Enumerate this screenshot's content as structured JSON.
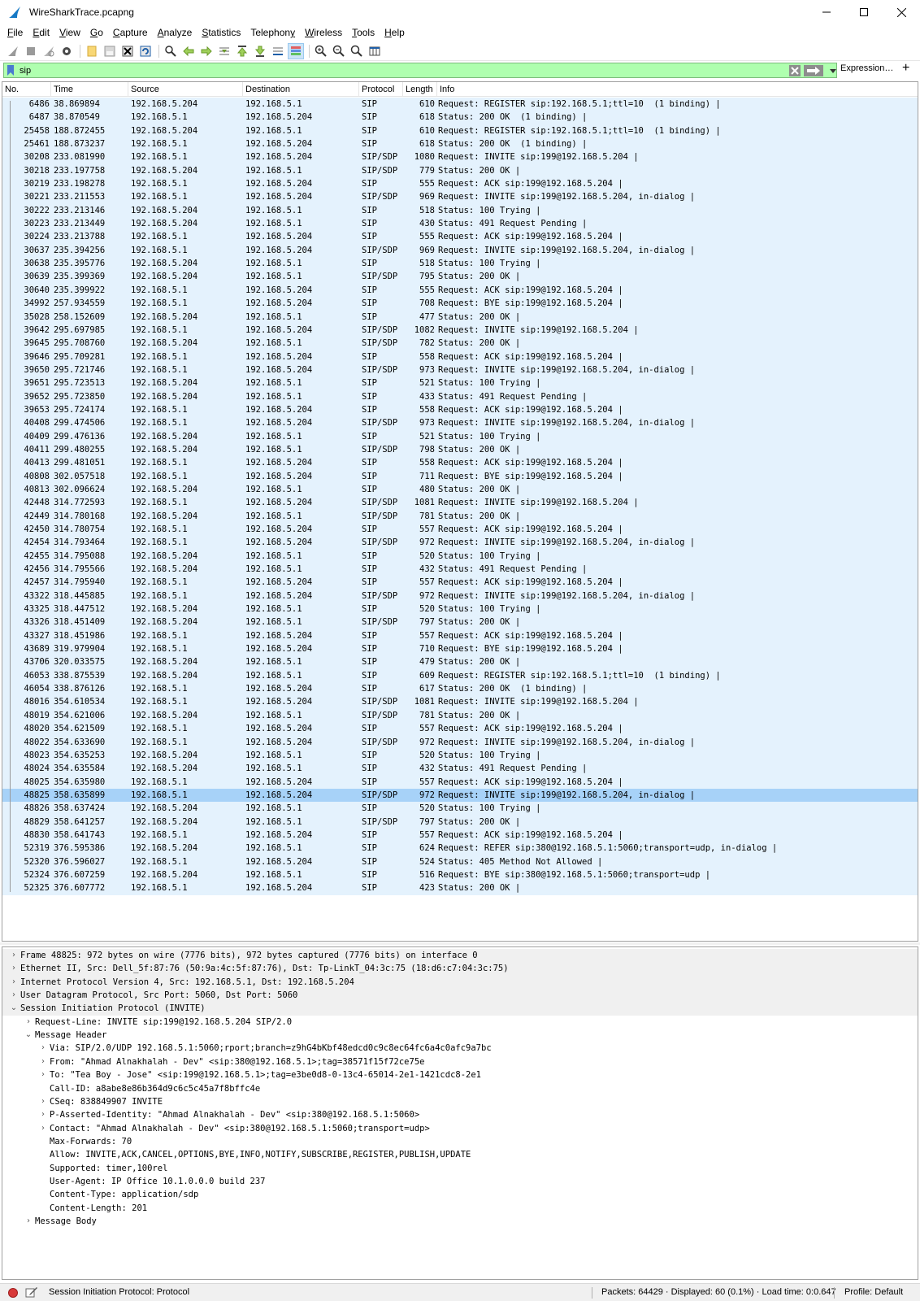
{
  "window": {
    "title": "WireSharkTrace.pcapng",
    "minimize_icon": "minimize-icon",
    "maximize_icon": "maximize-icon",
    "close_icon": "close-icon"
  },
  "menu": [
    {
      "label": "File",
      "key": "F",
      "rest": "ile"
    },
    {
      "label": "Edit",
      "key": "E",
      "rest": "dit"
    },
    {
      "label": "View",
      "key": "V",
      "rest": "iew"
    },
    {
      "label": "Go",
      "key": "G",
      "rest": "o"
    },
    {
      "label": "Capture",
      "key": "C",
      "rest": "apture"
    },
    {
      "label": "Analyze",
      "key": "A",
      "rest": "nalyze"
    },
    {
      "label": "Statistics",
      "key": "S",
      "rest": "tatistics"
    },
    {
      "label": "Telephony",
      "pre": "Telephon",
      "key": "y",
      "rest": ""
    },
    {
      "label": "Wireless",
      "key": "W",
      "rest": "ireless"
    },
    {
      "label": "Tools",
      "key": "T",
      "rest": "ools"
    },
    {
      "label": "Help",
      "key": "H",
      "rest": "elp"
    }
  ],
  "filter": {
    "value": "sip",
    "expression_label": "Expression…",
    "add_label": "+",
    "background": "#afffaf"
  },
  "columns": [
    "No.",
    "Time",
    "Source",
    "Destination",
    "Protocol",
    "Length",
    "Info"
  ],
  "packets": [
    [
      "6486",
      "38.869894",
      "192.168.5.204",
      "192.168.5.1",
      "SIP",
      "610",
      "Request: REGISTER sip:192.168.5.1;ttl=10  (1 binding) |"
    ],
    [
      "6487",
      "38.870549",
      "192.168.5.1",
      "192.168.5.204",
      "SIP",
      "618",
      "Status: 200 OK  (1 binding) |"
    ],
    [
      "25458",
      "188.872455",
      "192.168.5.204",
      "192.168.5.1",
      "SIP",
      "610",
      "Request: REGISTER sip:192.168.5.1;ttl=10  (1 binding) |"
    ],
    [
      "25461",
      "188.873237",
      "192.168.5.1",
      "192.168.5.204",
      "SIP",
      "618",
      "Status: 200 OK  (1 binding) |"
    ],
    [
      "30208",
      "233.081990",
      "192.168.5.1",
      "192.168.5.204",
      "SIP/SDP",
      "1080",
      "Request: INVITE sip:199@192.168.5.204 |"
    ],
    [
      "30218",
      "233.197758",
      "192.168.5.204",
      "192.168.5.1",
      "SIP/SDP",
      "779",
      "Status: 200 OK |"
    ],
    [
      "30219",
      "233.198278",
      "192.168.5.1",
      "192.168.5.204",
      "SIP",
      "555",
      "Request: ACK sip:199@192.168.5.204 |"
    ],
    [
      "30221",
      "233.211553",
      "192.168.5.1",
      "192.168.5.204",
      "SIP/SDP",
      "969",
      "Request: INVITE sip:199@192.168.5.204, in-dialog |"
    ],
    [
      "30222",
      "233.213146",
      "192.168.5.204",
      "192.168.5.1",
      "SIP",
      "518",
      "Status: 100 Trying |"
    ],
    [
      "30223",
      "233.213449",
      "192.168.5.204",
      "192.168.5.1",
      "SIP",
      "430",
      "Status: 491 Request Pending |"
    ],
    [
      "30224",
      "233.213788",
      "192.168.5.1",
      "192.168.5.204",
      "SIP",
      "555",
      "Request: ACK sip:199@192.168.5.204 |"
    ],
    [
      "30637",
      "235.394256",
      "192.168.5.1",
      "192.168.5.204",
      "SIP/SDP",
      "969",
      "Request: INVITE sip:199@192.168.5.204, in-dialog |"
    ],
    [
      "30638",
      "235.395776",
      "192.168.5.204",
      "192.168.5.1",
      "SIP",
      "518",
      "Status: 100 Trying |"
    ],
    [
      "30639",
      "235.399369",
      "192.168.5.204",
      "192.168.5.1",
      "SIP/SDP",
      "795",
      "Status: 200 OK |"
    ],
    [
      "30640",
      "235.399922",
      "192.168.5.1",
      "192.168.5.204",
      "SIP",
      "555",
      "Request: ACK sip:199@192.168.5.204 |"
    ],
    [
      "34992",
      "257.934559",
      "192.168.5.1",
      "192.168.5.204",
      "SIP",
      "708",
      "Request: BYE sip:199@192.168.5.204 |"
    ],
    [
      "35028",
      "258.152609",
      "192.168.5.204",
      "192.168.5.1",
      "SIP",
      "477",
      "Status: 200 OK |"
    ],
    [
      "39642",
      "295.697985",
      "192.168.5.1",
      "192.168.5.204",
      "SIP/SDP",
      "1082",
      "Request: INVITE sip:199@192.168.5.204 |"
    ],
    [
      "39645",
      "295.708760",
      "192.168.5.204",
      "192.168.5.1",
      "SIP/SDP",
      "782",
      "Status: 200 OK |"
    ],
    [
      "39646",
      "295.709281",
      "192.168.5.1",
      "192.168.5.204",
      "SIP",
      "558",
      "Request: ACK sip:199@192.168.5.204 |"
    ],
    [
      "39650",
      "295.721746",
      "192.168.5.1",
      "192.168.5.204",
      "SIP/SDP",
      "973",
      "Request: INVITE sip:199@192.168.5.204, in-dialog |"
    ],
    [
      "39651",
      "295.723513",
      "192.168.5.204",
      "192.168.5.1",
      "SIP",
      "521",
      "Status: 100 Trying |"
    ],
    [
      "39652",
      "295.723850",
      "192.168.5.204",
      "192.168.5.1",
      "SIP",
      "433",
      "Status: 491 Request Pending |"
    ],
    [
      "39653",
      "295.724174",
      "192.168.5.1",
      "192.168.5.204",
      "SIP",
      "558",
      "Request: ACK sip:199@192.168.5.204 |"
    ],
    [
      "40408",
      "299.474506",
      "192.168.5.1",
      "192.168.5.204",
      "SIP/SDP",
      "973",
      "Request: INVITE sip:199@192.168.5.204, in-dialog |"
    ],
    [
      "40409",
      "299.476136",
      "192.168.5.204",
      "192.168.5.1",
      "SIP",
      "521",
      "Status: 100 Trying |"
    ],
    [
      "40411",
      "299.480255",
      "192.168.5.204",
      "192.168.5.1",
      "SIP/SDP",
      "798",
      "Status: 200 OK |"
    ],
    [
      "40413",
      "299.481051",
      "192.168.5.1",
      "192.168.5.204",
      "SIP",
      "558",
      "Request: ACK sip:199@192.168.5.204 |"
    ],
    [
      "40808",
      "302.057518",
      "192.168.5.1",
      "192.168.5.204",
      "SIP",
      "711",
      "Request: BYE sip:199@192.168.5.204 |"
    ],
    [
      "40813",
      "302.096624",
      "192.168.5.204",
      "192.168.5.1",
      "SIP",
      "480",
      "Status: 200 OK |"
    ],
    [
      "42448",
      "314.772593",
      "192.168.5.1",
      "192.168.5.204",
      "SIP/SDP",
      "1081",
      "Request: INVITE sip:199@192.168.5.204 |"
    ],
    [
      "42449",
      "314.780168",
      "192.168.5.204",
      "192.168.5.1",
      "SIP/SDP",
      "781",
      "Status: 200 OK |"
    ],
    [
      "42450",
      "314.780754",
      "192.168.5.1",
      "192.168.5.204",
      "SIP",
      "557",
      "Request: ACK sip:199@192.168.5.204 |"
    ],
    [
      "42454",
      "314.793464",
      "192.168.5.1",
      "192.168.5.204",
      "SIP/SDP",
      "972",
      "Request: INVITE sip:199@192.168.5.204, in-dialog |"
    ],
    [
      "42455",
      "314.795088",
      "192.168.5.204",
      "192.168.5.1",
      "SIP",
      "520",
      "Status: 100 Trying |"
    ],
    [
      "42456",
      "314.795566",
      "192.168.5.204",
      "192.168.5.1",
      "SIP",
      "432",
      "Status: 491 Request Pending |"
    ],
    [
      "42457",
      "314.795940",
      "192.168.5.1",
      "192.168.5.204",
      "SIP",
      "557",
      "Request: ACK sip:199@192.168.5.204 |"
    ],
    [
      "43322",
      "318.445885",
      "192.168.5.1",
      "192.168.5.204",
      "SIP/SDP",
      "972",
      "Request: INVITE sip:199@192.168.5.204, in-dialog |"
    ],
    [
      "43325",
      "318.447512",
      "192.168.5.204",
      "192.168.5.1",
      "SIP",
      "520",
      "Status: 100 Trying |"
    ],
    [
      "43326",
      "318.451409",
      "192.168.5.204",
      "192.168.5.1",
      "SIP/SDP",
      "797",
      "Status: 200 OK |"
    ],
    [
      "43327",
      "318.451986",
      "192.168.5.1",
      "192.168.5.204",
      "SIP",
      "557",
      "Request: ACK sip:199@192.168.5.204 |"
    ],
    [
      "43689",
      "319.979904",
      "192.168.5.1",
      "192.168.5.204",
      "SIP",
      "710",
      "Request: BYE sip:199@192.168.5.204 |"
    ],
    [
      "43706",
      "320.033575",
      "192.168.5.204",
      "192.168.5.1",
      "SIP",
      "479",
      "Status: 200 OK |"
    ],
    [
      "46053",
      "338.875539",
      "192.168.5.204",
      "192.168.5.1",
      "SIP",
      "609",
      "Request: REGISTER sip:192.168.5.1;ttl=10  (1 binding) |"
    ],
    [
      "46054",
      "338.876126",
      "192.168.5.1",
      "192.168.5.204",
      "SIP",
      "617",
      "Status: 200 OK  (1 binding) |"
    ],
    [
      "48016",
      "354.610534",
      "192.168.5.1",
      "192.168.5.204",
      "SIP/SDP",
      "1081",
      "Request: INVITE sip:199@192.168.5.204 |"
    ],
    [
      "48019",
      "354.621006",
      "192.168.5.204",
      "192.168.5.1",
      "SIP/SDP",
      "781",
      "Status: 200 OK |"
    ],
    [
      "48020",
      "354.621509",
      "192.168.5.1",
      "192.168.5.204",
      "SIP",
      "557",
      "Request: ACK sip:199@192.168.5.204 |"
    ],
    [
      "48022",
      "354.633690",
      "192.168.5.1",
      "192.168.5.204",
      "SIP/SDP",
      "972",
      "Request: INVITE sip:199@192.168.5.204, in-dialog |"
    ],
    [
      "48023",
      "354.635253",
      "192.168.5.204",
      "192.168.5.1",
      "SIP",
      "520",
      "Status: 100 Trying |"
    ],
    [
      "48024",
      "354.635584",
      "192.168.5.204",
      "192.168.5.1",
      "SIP",
      "432",
      "Status: 491 Request Pending |"
    ],
    [
      "48025",
      "354.635980",
      "192.168.5.1",
      "192.168.5.204",
      "SIP",
      "557",
      "Request: ACK sip:199@192.168.5.204 |"
    ],
    [
      "48825",
      "358.635899",
      "192.168.5.1",
      "192.168.5.204",
      "SIP/SDP",
      "972",
      "Request: INVITE sip:199@192.168.5.204, in-dialog |"
    ],
    [
      "48826",
      "358.637424",
      "192.168.5.204",
      "192.168.5.1",
      "SIP",
      "520",
      "Status: 100 Trying |"
    ],
    [
      "48829",
      "358.641257",
      "192.168.5.204",
      "192.168.5.1",
      "SIP/SDP",
      "797",
      "Status: 200 OK |"
    ],
    [
      "48830",
      "358.641743",
      "192.168.5.1",
      "192.168.5.204",
      "SIP",
      "557",
      "Request: ACK sip:199@192.168.5.204 |"
    ],
    [
      "52319",
      "376.595386",
      "192.168.5.204",
      "192.168.5.1",
      "SIP",
      "624",
      "Request: REFER sip:380@192.168.5.1:5060;transport=udp, in-dialog |"
    ],
    [
      "52320",
      "376.596027",
      "192.168.5.1",
      "192.168.5.204",
      "SIP",
      "524",
      "Status: 405 Method Not Allowed |"
    ],
    [
      "52324",
      "376.607259",
      "192.168.5.204",
      "192.168.5.1",
      "SIP",
      "516",
      "Request: BYE sip:380@192.168.5.1:5060;transport=udp |"
    ],
    [
      "52325",
      "376.607772",
      "192.168.5.1",
      "192.168.5.204",
      "SIP",
      "423",
      "Status: 200 OK |"
    ]
  ],
  "selected_packet": "48825",
  "row_color": "#e4f2fd",
  "selected_row_color": "#a7d2f8",
  "details": [
    {
      "text": "Frame 48825: 972 bytes on wire (7776 bits), 972 bytes captured (7776 bits) on interface 0",
      "level": 0,
      "arrow": "›",
      "top": true
    },
    {
      "text": "Ethernet II, Src: Dell_5f:87:76 (50:9a:4c:5f:87:76), Dst: Tp-LinkT_04:3c:75 (18:d6:c7:04:3c:75)",
      "level": 0,
      "arrow": "›",
      "top": true
    },
    {
      "text": "Internet Protocol Version 4, Src: 192.168.5.1, Dst: 192.168.5.204",
      "level": 0,
      "arrow": "›",
      "top": true
    },
    {
      "text": "User Datagram Protocol, Src Port: 5060, Dst Port: 5060",
      "level": 0,
      "arrow": "›",
      "top": true
    },
    {
      "text": "Session Initiation Protocol (INVITE)",
      "level": 0,
      "arrow": "⌄",
      "top": true
    },
    {
      "text": "Request-Line: INVITE sip:199@192.168.5.204 SIP/2.0",
      "level": 1,
      "arrow": "›"
    },
    {
      "text": "Message Header",
      "level": 1,
      "arrow": "⌄"
    },
    {
      "text": "Via: SIP/2.0/UDP 192.168.5.1:5060;rport;branch=z9hG4bKbf48edcd0c9c8ec64fc6a4c0afc9a7bc",
      "level": 2,
      "arrow": "›"
    },
    {
      "text": "From: \"Ahmad Alnakhalah - Dev\" <sip:380@192.168.5.1>;tag=38571f15f72ce75e",
      "level": 2,
      "arrow": "›"
    },
    {
      "text": "To: \"Tea Boy - Jose\" <sip:199@192.168.5.1>;tag=e3be0d8-0-13c4-65014-2e1-1421cdc8-2e1",
      "level": 2,
      "arrow": "›"
    },
    {
      "text": "Call-ID: a8abe8e86b364d9c6c5c45a7f8bffc4e",
      "level": 2,
      "arrow": ""
    },
    {
      "text": "CSeq: 838849907 INVITE",
      "level": 2,
      "arrow": "›"
    },
    {
      "text": "P-Asserted-Identity: \"Ahmad Alnakhalah - Dev\" <sip:380@192.168.5.1:5060>",
      "level": 2,
      "arrow": "›"
    },
    {
      "text": "Contact: \"Ahmad Alnakhalah - Dev\" <sip:380@192.168.5.1:5060;transport=udp>",
      "level": 2,
      "arrow": "›"
    },
    {
      "text": "Max-Forwards: 70",
      "level": 2,
      "arrow": ""
    },
    {
      "text": "Allow: INVITE,ACK,CANCEL,OPTIONS,BYE,INFO,NOTIFY,SUBSCRIBE,REGISTER,PUBLISH,UPDATE",
      "level": 2,
      "arrow": ""
    },
    {
      "text": "Supported: timer,100rel",
      "level": 2,
      "arrow": ""
    },
    {
      "text": "User-Agent: IP Office 10.1.0.0.0 build 237",
      "level": 2,
      "arrow": ""
    },
    {
      "text": "Content-Type: application/sdp",
      "level": 2,
      "arrow": ""
    },
    {
      "text": "Content-Length: 201",
      "level": 2,
      "arrow": ""
    },
    {
      "text": "Message Body",
      "level": 1,
      "arrow": "›"
    }
  ],
  "statusbar": {
    "protocol": "Session Initiation Protocol: Protocol",
    "packets": "Packets: 64429 · Displayed: 60 (0.1%) · Load time: 0:0.647",
    "profile": "Profile: Default"
  }
}
